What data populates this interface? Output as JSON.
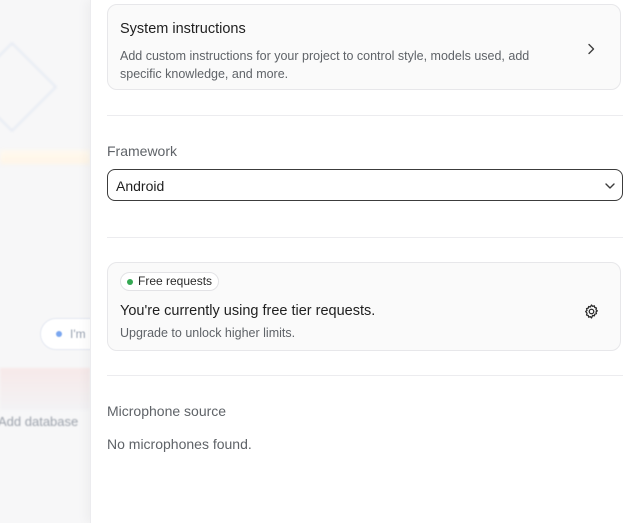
{
  "background": {
    "pill_text": "I'm",
    "add_text": "Add database"
  },
  "system_instructions": {
    "title": "System instructions",
    "description": "Add custom instructions for your project to control style, models used, add specific knowledge, and more.",
    "icon": "chevron-right-icon"
  },
  "framework": {
    "label": "Framework",
    "selected": "Android",
    "icon": "chevron-down-icon"
  },
  "free_tier": {
    "badge": "Free requests",
    "badge_color": "#34a853",
    "title": "You're currently using free tier requests.",
    "subtitle": "Upgrade to unlock higher limits.",
    "icon": "gear-icon"
  },
  "microphone": {
    "label": "Microphone source",
    "empty_text": "No microphones found."
  }
}
